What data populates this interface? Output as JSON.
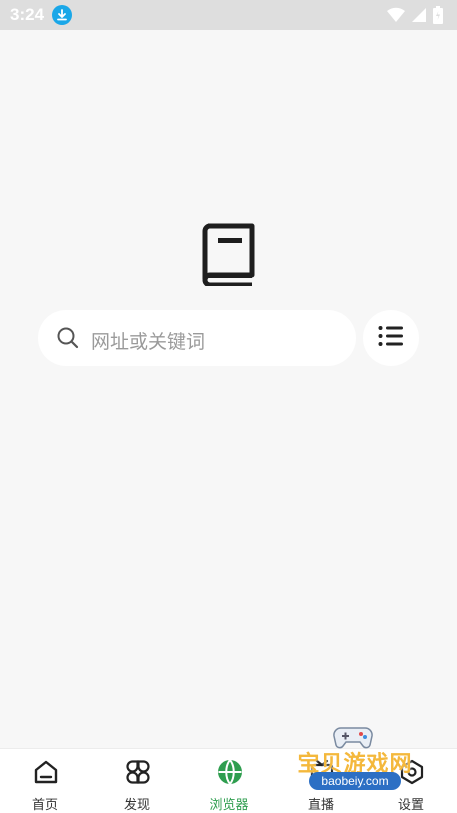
{
  "status_bar": {
    "time": "3:24"
  },
  "search": {
    "placeholder": "网址或关键词"
  },
  "nav": {
    "items": [
      {
        "label": "首页",
        "icon": "home-icon"
      },
      {
        "label": "发现",
        "icon": "discover-icon"
      },
      {
        "label": "浏览器",
        "icon": "globe-icon"
      },
      {
        "label": "直播",
        "icon": "live-icon"
      },
      {
        "label": "设置",
        "icon": "settings-icon"
      }
    ],
    "active_index": 2
  },
  "watermark": {
    "text": "宝贝游戏网",
    "domain": "baobeiy.com"
  },
  "colors": {
    "accent": "#2f9e4f",
    "background": "#f7f7f7",
    "status_badge": "#1aa7e8"
  }
}
